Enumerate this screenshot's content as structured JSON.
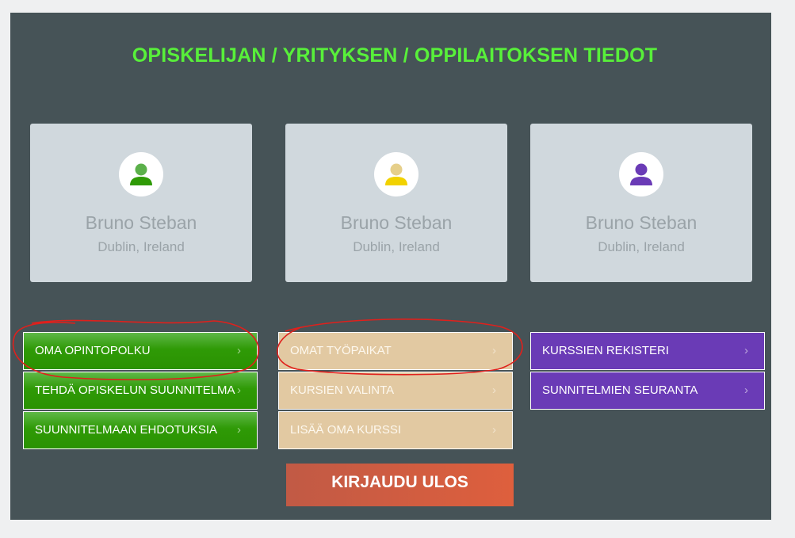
{
  "page": {
    "title": "OPISKELIJAN / YRITYKSEN / OPPILAITOKSEN TIEDOT",
    "title_color": "#58f03a",
    "background_color": "#465357"
  },
  "cards": [
    {
      "name": "Bruno Steban",
      "location": "Dublin, Ireland",
      "avatar_color": "#2f9a06",
      "icon": "user-icon"
    },
    {
      "name": "Bruno Steban",
      "location": "Dublin, Ireland",
      "avatar_color": "#f2d200",
      "icon": "user-icon"
    },
    {
      "name": "Bruno Steban",
      "location": "Dublin, Ireland",
      "avatar_color": "#6a3bb6",
      "icon": "user-icon"
    }
  ],
  "menus": {
    "student": {
      "color": "#2f9a06",
      "items": [
        {
          "label": "OMA OPINTOPOLKU"
        },
        {
          "label": "TEHDÄ OPISKELUN SUUNNITELMA"
        },
        {
          "label": "SUUNNITELMAAN EHDOTUKSIA"
        }
      ]
    },
    "company": {
      "color": "#e2c9a2",
      "items": [
        {
          "label": "OMAT TYÖPAIKAT"
        },
        {
          "label": "KURSIEN VALINTA"
        },
        {
          "label": "LISÄÄ OMA KURSSI"
        }
      ]
    },
    "school": {
      "color": "#6a3bb6",
      "items": [
        {
          "label": "KURSSIEN REKISTERI"
        },
        {
          "label": "SUNNITELMIEN SEURANTA"
        }
      ]
    }
  },
  "chevron": "›",
  "logout_label": "KIRJAUDU ULOS",
  "logout_color": "#de5f3d",
  "annotation_color": "#e0201c"
}
